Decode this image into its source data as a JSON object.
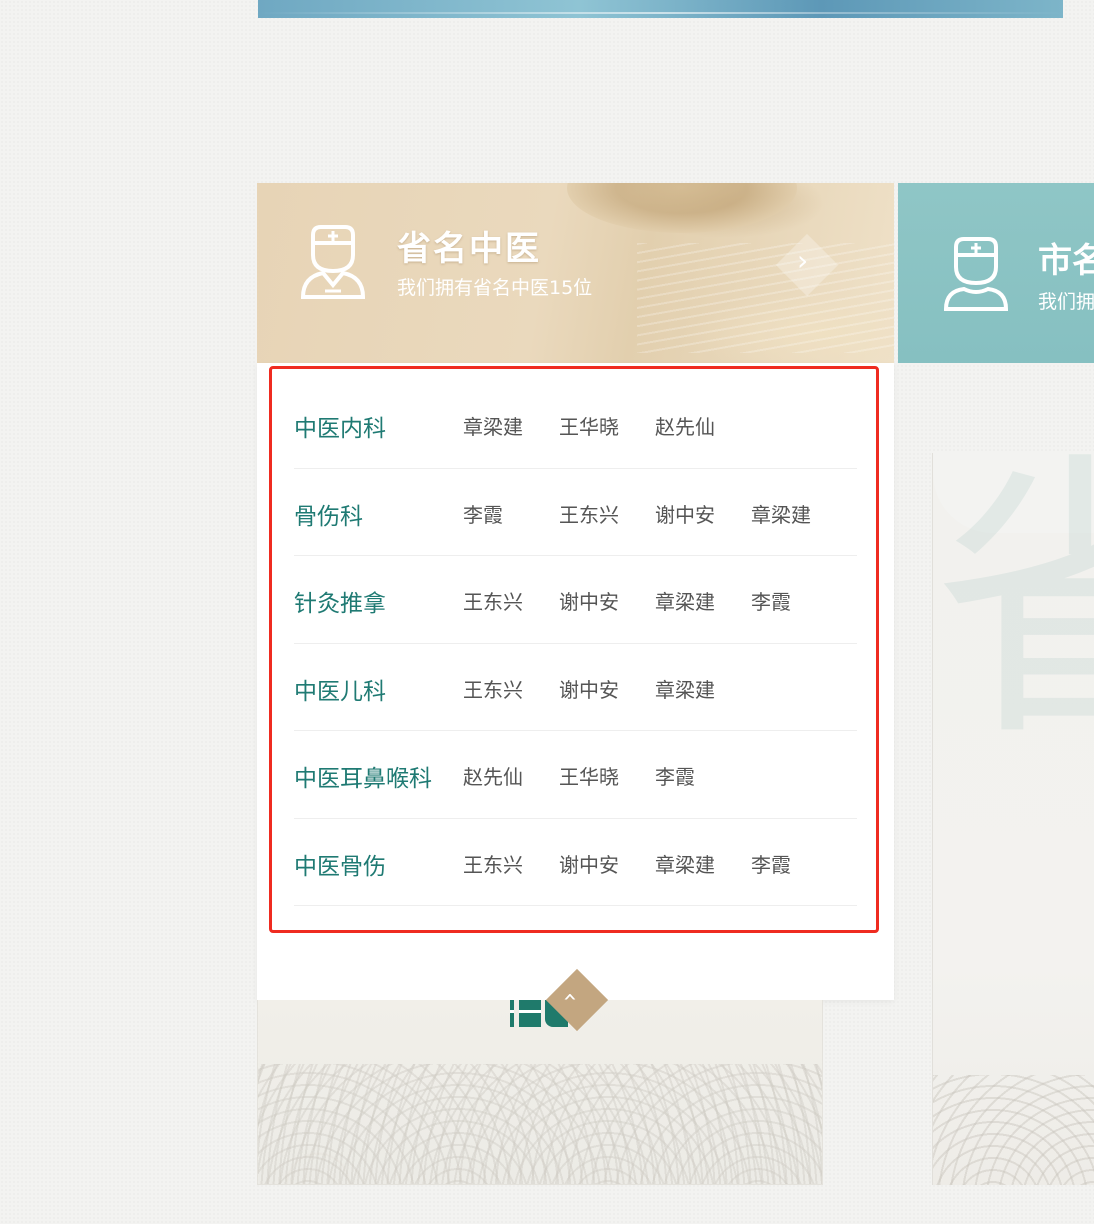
{
  "card1": {
    "title": "省名中医",
    "subtitle": "我们拥有省名中医15位",
    "icon": "doctor-icon",
    "arrow_icon": "chevron-right-icon",
    "header_color": "#e7d4b6",
    "accent_color": "#1f7a73",
    "highlight_color": "#ef2b20",
    "departments": [
      {
        "name": "中医内科",
        "doctors": [
          "章梁建",
          "王华晓",
          "赵先仙"
        ]
      },
      {
        "name": "骨伤科",
        "doctors": [
          "李霞",
          "王东兴",
          "谢中安",
          "章梁建"
        ]
      },
      {
        "name": "针灸推拿",
        "doctors": [
          "王东兴",
          "谢中安",
          "章梁建",
          "李霞"
        ]
      },
      {
        "name": "中医儿科",
        "doctors": [
          "王东兴",
          "谢中安",
          "章梁建"
        ]
      },
      {
        "name": "中医耳鼻喉科",
        "doctors": [
          "赵先仙",
          "王华晓",
          "李霞"
        ]
      },
      {
        "name": "中医骨伤",
        "doctors": [
          "王东兴",
          "谢中安",
          "章梁建",
          "李霞"
        ]
      }
    ],
    "collapse_icon": "chevron-up-icon",
    "collapse_color": "#c3a680"
  },
  "card2": {
    "title": "市名",
    "subtitle": "我们拥",
    "icon": "doctor-icon",
    "header_color": "#8fc6c6",
    "bg_char": "省"
  }
}
